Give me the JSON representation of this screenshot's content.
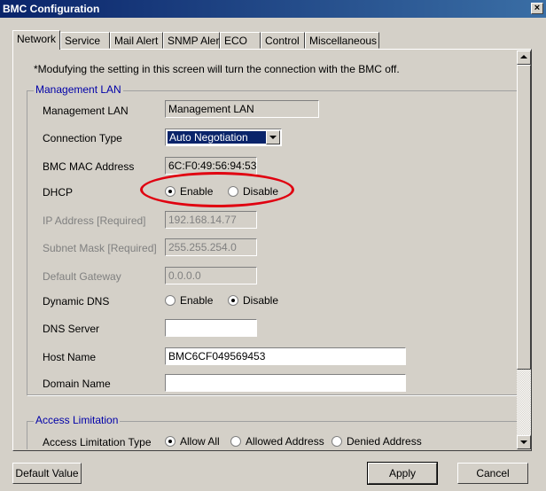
{
  "window": {
    "title": "BMC Configuration",
    "close_glyph": "×"
  },
  "tabs": [
    "Network",
    "Service",
    "Mail Alert",
    "SNMP Alert",
    "ECO",
    "Control",
    "Miscellaneous"
  ],
  "notice": "*Modufying the setting in this screen will turn the connection with the BMC off.",
  "management_lan": {
    "group_title": "Management LAN",
    "rows": {
      "lan_label": "Management LAN",
      "lan_value": "Management LAN",
      "conn_label": "Connection Type",
      "conn_value": "Auto Negotiation",
      "mac_label": "BMC MAC Address",
      "mac_value": "6C:F0:49:56:94:53",
      "dhcp_label": "DHCP",
      "dhcp_enable": "Enable",
      "dhcp_disable": "Disable",
      "ip_label": "IP Address  [Required]",
      "ip_value": "192.168.14.77",
      "mask_label": "Subnet Mask  [Required]",
      "mask_value": "255.255.254.0",
      "gw_label": "Default Gateway",
      "gw_value": "0.0.0.0",
      "ddns_label": "Dynamic DNS",
      "ddns_enable": "Enable",
      "ddns_disable": "Disable",
      "dns_label": "DNS Server",
      "dns_value": "",
      "host_label": "Host Name",
      "host_value": "BMC6CF049569453",
      "domain_label": "Domain Name",
      "domain_value": ""
    }
  },
  "access_limitation": {
    "group_title": "Access Limitation",
    "type_label": "Access Limitation Type",
    "options": [
      "Allow All",
      "Allowed Address",
      "Denied Address"
    ]
  },
  "buttons": {
    "default_value": "Default Value",
    "apply": "Apply",
    "cancel": "Cancel"
  }
}
